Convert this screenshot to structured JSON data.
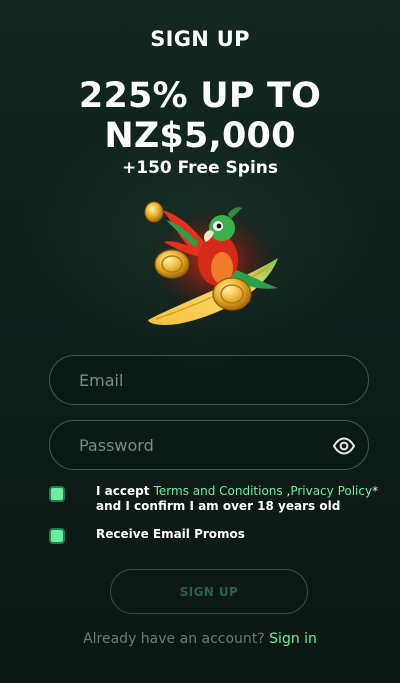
{
  "header": {
    "title": "SIGN UP",
    "headline_line1": "225% UP TO",
    "headline_line2": "NZ$5,000",
    "spins": "+150 Free Spins"
  },
  "form": {
    "email_placeholder": "Email",
    "password_placeholder": "Password",
    "terms_prefix": "I accept ",
    "terms_link": "Terms and Conditions",
    "privacy_sep": " ,",
    "privacy_link": "Privacy Policy",
    "privacy_star": "*",
    "age_text": " and I confirm I am over 18 years old",
    "terms_checked": true,
    "promos_label": "Receive Email Promos",
    "promos_checked": true,
    "submit_label": "SIGN UP"
  },
  "footer": {
    "prompt": "Already have an account?",
    "signin_label": "Sign in"
  },
  "colors": {
    "accent": "#6dee9e",
    "background": "#0f1c17",
    "field_border": "#3f5a4e"
  },
  "icons": {
    "password_toggle": "eye-icon",
    "hero": "parrot-surfboard-illustration"
  }
}
